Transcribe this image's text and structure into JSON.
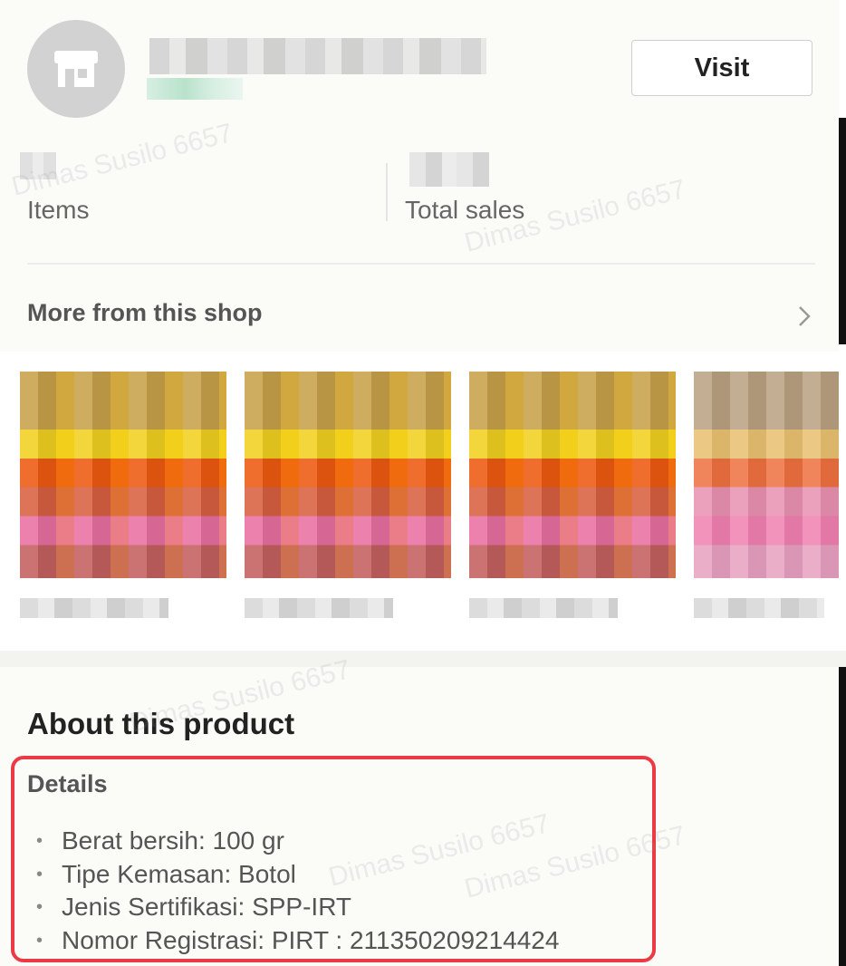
{
  "shop": {
    "visit_label": "Visit",
    "items_label": "Items",
    "total_sales_label": "Total sales"
  },
  "more_from_shop": {
    "title": "More from this shop",
    "products": [
      {
        "image": "product-image-1"
      },
      {
        "image": "product-image-2"
      },
      {
        "image": "product-image-3"
      },
      {
        "image": "product-image-4"
      }
    ]
  },
  "about": {
    "title": "About this product",
    "details_title": "Details",
    "details": [
      "Berat bersih: 100 gr",
      "Tipe Kemasan: Botol",
      "Jenis Sertifikasi: SPP-IRT",
      "Nomor Registrasi: PIRT : 211350209214424"
    ]
  },
  "watermark": "Dimas Susilo 6657",
  "colors": {
    "highlight": "#ec3a44",
    "avatar": "#d2d2d2",
    "background": "#fbfbf8"
  },
  "icons": [
    "store-icon",
    "chevron-right-icon"
  ]
}
